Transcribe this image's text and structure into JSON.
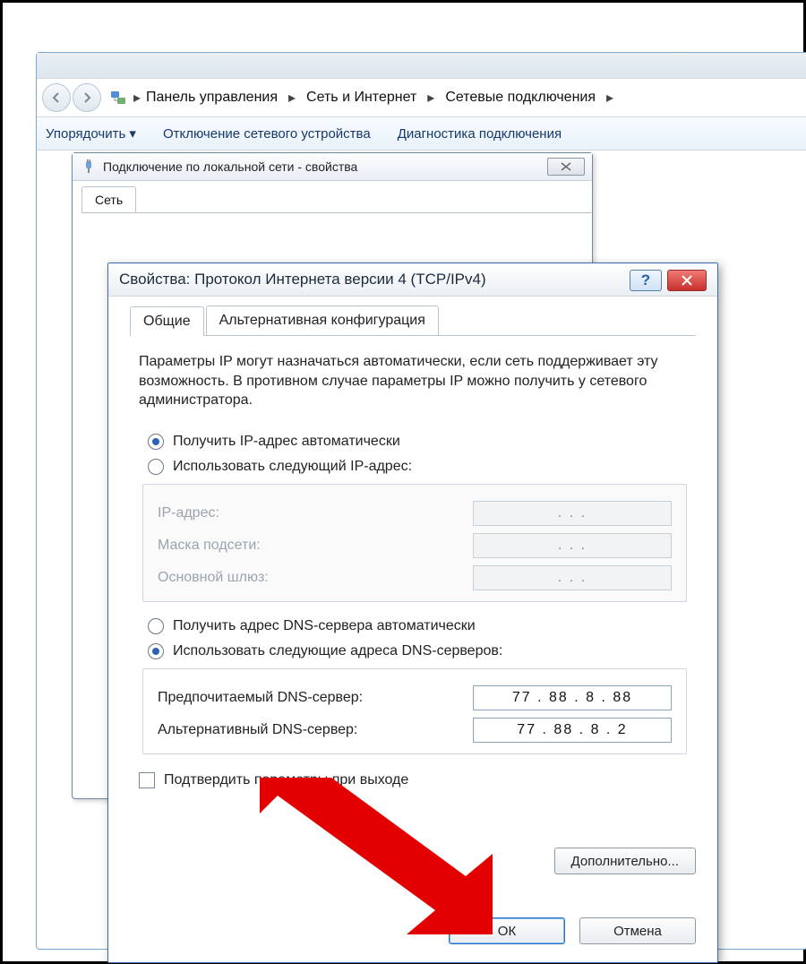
{
  "explorer": {
    "breadcrumb": [
      "Панель управления",
      "Сеть и Интернет",
      "Сетевые подключения"
    ],
    "commands": [
      "Упорядочить ▾",
      "Отключение сетевого устройства",
      "Диагностика подключения"
    ]
  },
  "props": {
    "title": "Подключение по локальной сети - свойства",
    "tab": "Сеть"
  },
  "ipv4": {
    "title": "Свойства: Протокол Интернета версии 4 (TCP/IPv4)",
    "tabs": {
      "general": "Общие",
      "alt": "Альтернативная конфигурация"
    },
    "help_text": "Параметры IP могут назначаться автоматически, если сеть поддерживает эту возможность. В противном случае параметры IP можно получить у сетевого администратора.",
    "radio_ip_auto": "Получить IP-адрес автоматически",
    "radio_ip_manual": "Использовать следующий IP-адрес:",
    "fields_ip": {
      "ip": "IP-адрес:",
      "mask": "Маска подсети:",
      "gw": "Основной шлюз:",
      "val_blank": ".       .       ."
    },
    "radio_dns_auto": "Получить адрес DNS-сервера автоматически",
    "radio_dns_manual": "Использовать следующие адреса DNS-серверов:",
    "fields_dns": {
      "pref_label": "Предпочитаемый DNS-сервер:",
      "pref_value": "77  .  88  .   8   .   88",
      "alt_label": "Альтернативный DNS-сервер:",
      "alt_value": "77  .  88  .   8   .    2"
    },
    "chk_validate": "Подтвердить параметры при выходе",
    "btn_advanced": "Дополнительно...",
    "btn_ok": "ОК",
    "btn_cancel": "Отмена"
  }
}
